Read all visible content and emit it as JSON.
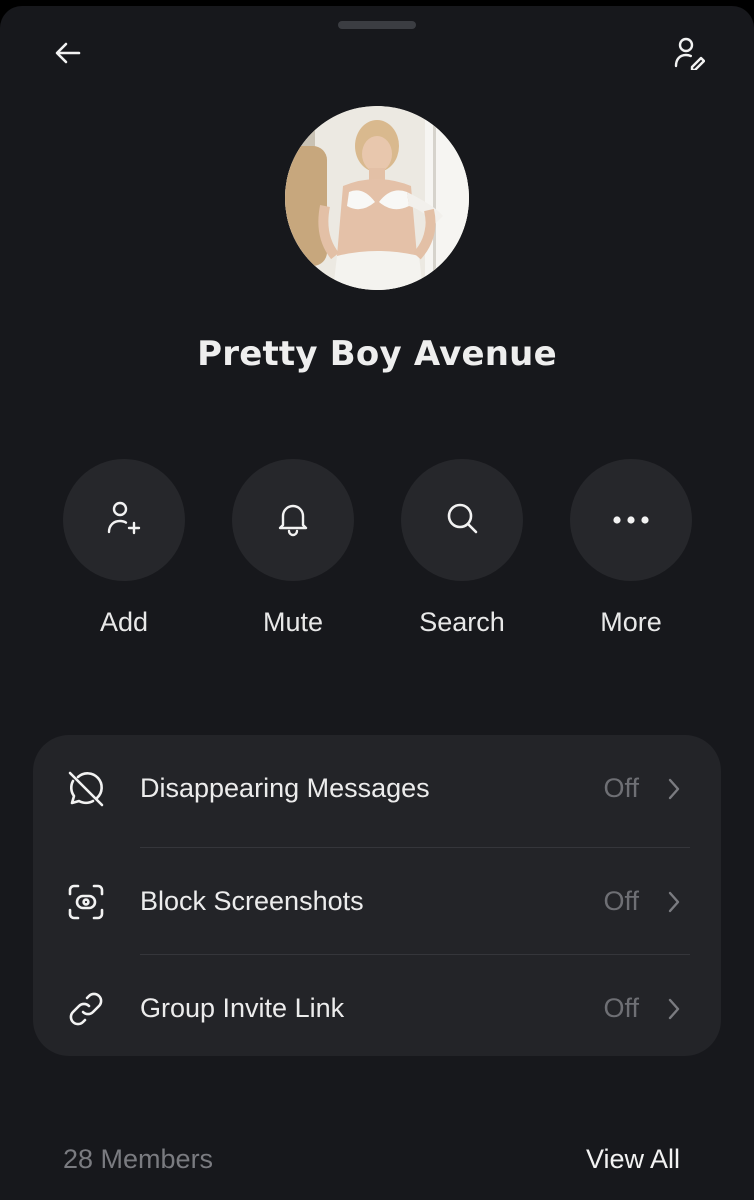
{
  "header": {
    "back_icon": "arrow-left-icon",
    "edit_icon": "person-edit-icon"
  },
  "group": {
    "name": "Pretty Boy Avenue",
    "avatar_description": "photo"
  },
  "actions": [
    {
      "label": "Add",
      "icon": "person-add-icon"
    },
    {
      "label": "Mute",
      "icon": "bell-icon"
    },
    {
      "label": "Search",
      "icon": "search-icon"
    },
    {
      "label": "More",
      "icon": "more-horizontal-icon"
    }
  ],
  "settings": [
    {
      "label": "Disappearing Messages",
      "value": "Off",
      "icon": "disappearing-messages-off-icon"
    },
    {
      "label": "Block Screenshots",
      "value": "Off",
      "icon": "screenshot-block-icon"
    },
    {
      "label": "Group Invite Link",
      "value": "Off",
      "icon": "link-icon"
    }
  ],
  "members": {
    "count_label": "28 Members",
    "view_all_label": "View All"
  },
  "colors": {
    "background": "#17181c",
    "card": "#232428",
    "action_circle": "#26272b",
    "text_primary": "#ececec",
    "text_secondary": "#6e6f74"
  }
}
